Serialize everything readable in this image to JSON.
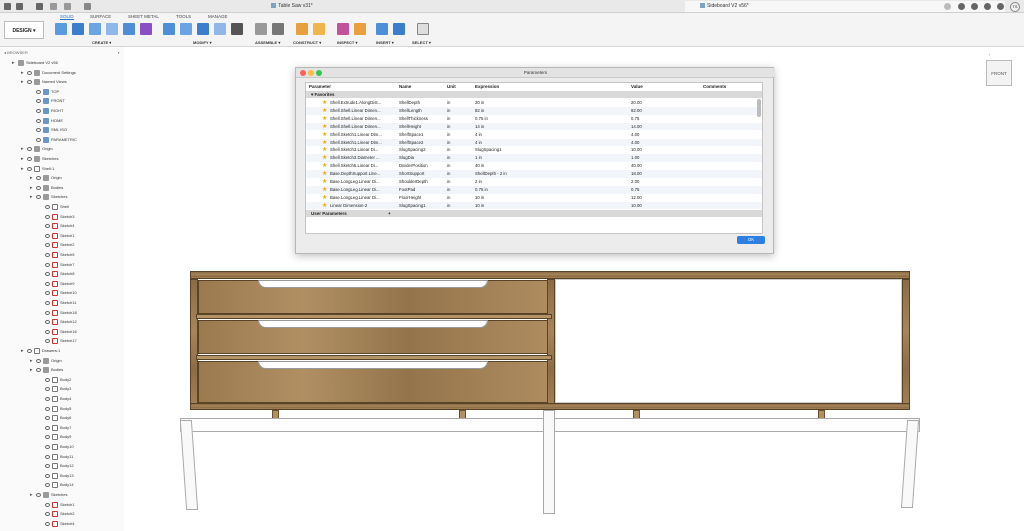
{
  "tabs": [
    {
      "label": "Table Saw v31*"
    },
    {
      "label": "Sideboard V2 v56*"
    }
  ],
  "user_initials": "TS",
  "ribbon": {
    "tabs": [
      "SOLID",
      "SURFACE",
      "SHEET METAL",
      "TOOLS",
      "MANAGE"
    ],
    "active_tab": "SOLID",
    "workspace": "DESIGN ▾",
    "groups": [
      "CREATE ▾",
      "MODIFY ▾",
      "ASSEMBLE ▾",
      "CONSTRUCT ▾",
      "INSPECT ▾",
      "INSERT ▾",
      "SELECT ▾"
    ]
  },
  "browser": {
    "title": "BROWSER",
    "root": "Sideboard V2 v56",
    "items": [
      "Document Settings",
      "Named Views",
      "TOP",
      "FRONT",
      "RIGHT",
      "HOME",
      "SML ISO",
      "PARAMETRIC",
      "Origin",
      "Sketches",
      "Shell:1",
      "Origin",
      "Bodies",
      "Sketches",
      "Shell",
      "Sketch3",
      "Sketch4",
      "Sketch1",
      "Sketch2",
      "Sketch5",
      "Sketch7",
      "Sketch8",
      "Sketch9",
      "Sketch10",
      "Sketch11",
      "Sketch18",
      "Sketch12",
      "Sketch16",
      "Sketch17",
      "Drawers:1",
      "Origin",
      "Bodies",
      "Body2",
      "Body3",
      "Body4",
      "Body5",
      "Body6",
      "Body7",
      "Body9",
      "Body10",
      "Body11",
      "Body12",
      "Body13",
      "Body14",
      "Sketches",
      "Sketch1",
      "Sketch2",
      "Sketch4"
    ]
  },
  "dialog": {
    "title": "Parameters",
    "columns": [
      "Parameter",
      "Name",
      "Unit",
      "Expression",
      "Value",
      "Comments"
    ],
    "favorites_label": "Favorites",
    "rows": [
      {
        "parameter": "Shell.Extrude1.AlongDist...",
        "name": "ShellDepth",
        "unit": "in",
        "expression": "20 in",
        "value": "20.00"
      },
      {
        "parameter": "Shell.Shell.Linear Dimen...",
        "name": "ShellLength",
        "unit": "in",
        "expression": "82 in",
        "value": "82.00"
      },
      {
        "parameter": "Shell.Shell.Linear Dimen...",
        "name": "ShellThickness",
        "unit": "in",
        "expression": "0.75 in",
        "value": "0.75"
      },
      {
        "parameter": "Shell.Shell.Linear Dimen...",
        "name": "ShellHeight",
        "unit": "in",
        "expression": "14 in",
        "value": "14.00"
      },
      {
        "parameter": "Shell.Sketch1.Linear Dim...",
        "name": "ShelfSpace1",
        "unit": "in",
        "expression": "4 in",
        "value": "4.00"
      },
      {
        "parameter": "Shell.Sketch1.Linear Dim...",
        "name": "ShelfSpace2",
        "unit": "in",
        "expression": "4 in",
        "value": "4.00"
      },
      {
        "parameter": "Shell.Sketch3.Linear Di...",
        "name": "SlugSpacing2",
        "unit": "in",
        "expression": "SlugSpacing1",
        "value": "10.00"
      },
      {
        "parameter": "Shell.Sketch3.Diameter ...",
        "name": "SlugDia",
        "unit": "in",
        "expression": "1 in",
        "value": "1.00"
      },
      {
        "parameter": "Shell.Sketch5.Linear Di...",
        "name": "DividerPosition",
        "unit": "in",
        "expression": "40 in",
        "value": "40.00"
      },
      {
        "parameter": "Base.DepthSupport.Line...",
        "name": "ShortSupport",
        "unit": "in",
        "expression": "ShellDepth - 2 in",
        "value": "18.00"
      },
      {
        "parameter": "Base.LongLeg.Linear Di...",
        "name": "ShoulderDepth",
        "unit": "in",
        "expression": "2 in",
        "value": "2.00"
      },
      {
        "parameter": "Base.LongLeg.Linear Di...",
        "name": "FootPad",
        "unit": "in",
        "expression": "0.75 in",
        "value": "0.75"
      },
      {
        "parameter": "Base.LongLeg.Linear Di...",
        "name": "FloorHeight",
        "unit": "in",
        "expression": "10 in",
        "value": "12.00"
      },
      {
        "parameter": "Linear Dimension-2",
        "name": "SlugSpacing1",
        "unit": "in",
        "expression": "10 in",
        "value": "10.00"
      }
    ],
    "user_parameters_label": "User Parameters",
    "ok_label": "OK"
  },
  "viewcube_label": "FRONT"
}
